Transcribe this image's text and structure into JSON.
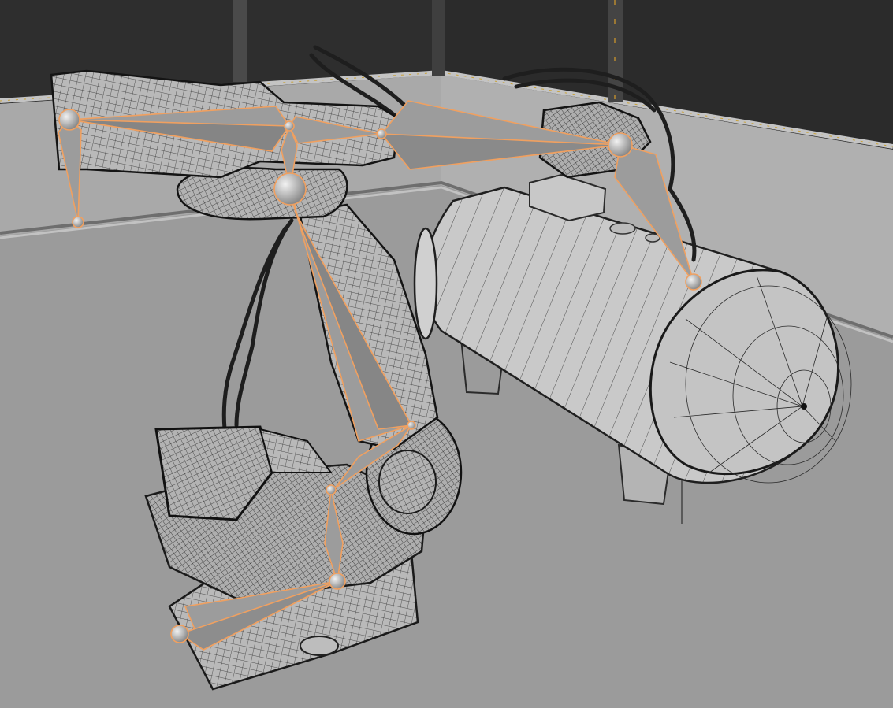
{
  "viewport": {
    "view_mode": "wireframe-overlay",
    "selection_color": "#f0a060",
    "bone_fill": "#9c9c9c",
    "joint_color": "#d8d8d8",
    "floor_color": "#9b9b9b",
    "back_wall_color": "#2e2e2e",
    "trim_color": "#b5b5b5",
    "mesh_wire_color": "#1c1c1c",
    "objects": [
      {
        "name": "industrial-robot-arm",
        "type": "mesh"
      },
      {
        "name": "air-compressor-tank",
        "type": "mesh"
      },
      {
        "name": "robot-armature",
        "type": "armature",
        "selected": true,
        "bone_count": 8
      }
    ]
  }
}
